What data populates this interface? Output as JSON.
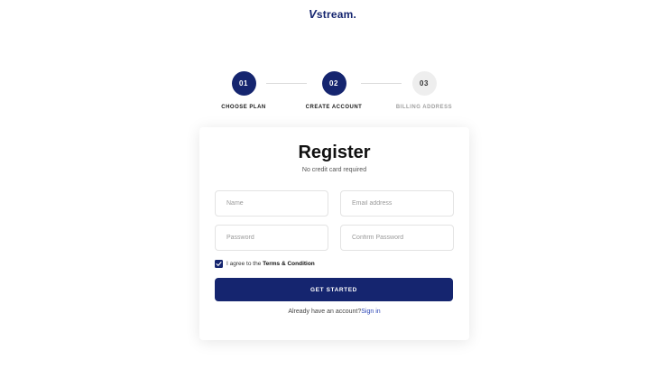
{
  "brand": {
    "logo_mark": "V",
    "logo_text": "stream."
  },
  "stepper": {
    "steps": [
      {
        "number": "01",
        "label": "CHOOSE PLAN",
        "state": "active"
      },
      {
        "number": "02",
        "label": "CREATE ACCOUNT",
        "state": "active"
      },
      {
        "number": "03",
        "label": "BILLING ADDRESS",
        "state": "inactive"
      }
    ]
  },
  "form": {
    "title": "Register",
    "subtitle": "No credit card required",
    "fields": {
      "name": {
        "placeholder": "Name",
        "value": ""
      },
      "email": {
        "placeholder": "Email address",
        "value": ""
      },
      "password": {
        "placeholder": "Password",
        "value": ""
      },
      "confirm_password": {
        "placeholder": "Confirm Password",
        "value": ""
      }
    },
    "agree": {
      "checked": true,
      "text": "I agree to the ",
      "link": "Terms & Condition"
    },
    "submit_label": "GET STARTED",
    "signin": {
      "text": "Already have an account?",
      "link": "Sign in"
    }
  },
  "colors": {
    "primary": "#15256f",
    "inactive": "#eeeeee",
    "link": "#2b45b6"
  },
  "icons": {
    "check": "check-icon"
  }
}
